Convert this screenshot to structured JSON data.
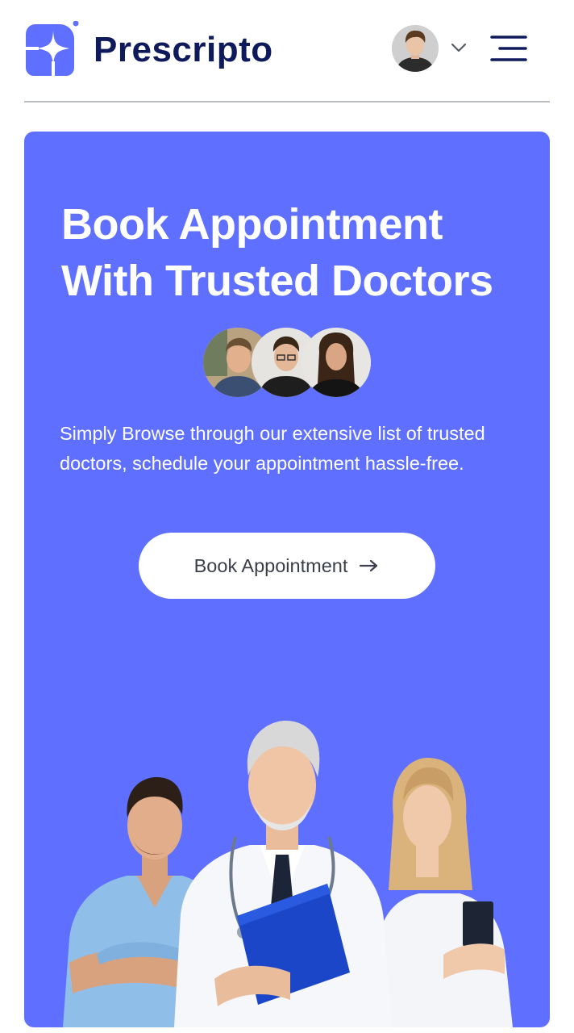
{
  "header": {
    "brand_name": "Prescripto",
    "logo_icon": "prescripto-logo-icon",
    "avatar_icon": "user-avatar",
    "dropdown_icon": "chevron-down-icon",
    "menu_icon": "hamburger-menu-icon"
  },
  "hero": {
    "title_line1": "Book Appointment",
    "title_line2": "With Trusted Doctors",
    "description": "Simply Browse through our extensive list of trusted doctors, schedule your appointment hassle-free.",
    "cta_label": "Book Appointment",
    "cta_icon": "arrow-right-icon",
    "group_avatars": [
      "doctor-avatar",
      "doctor-avatar",
      "doctor-avatar"
    ],
    "hero_image": "doctors-group-image"
  },
  "colors": {
    "brand": "#5f6fff",
    "brand_text": "#0f1a5c",
    "cta_bg": "#ffffff",
    "cta_text": "#3b3f4a"
  }
}
